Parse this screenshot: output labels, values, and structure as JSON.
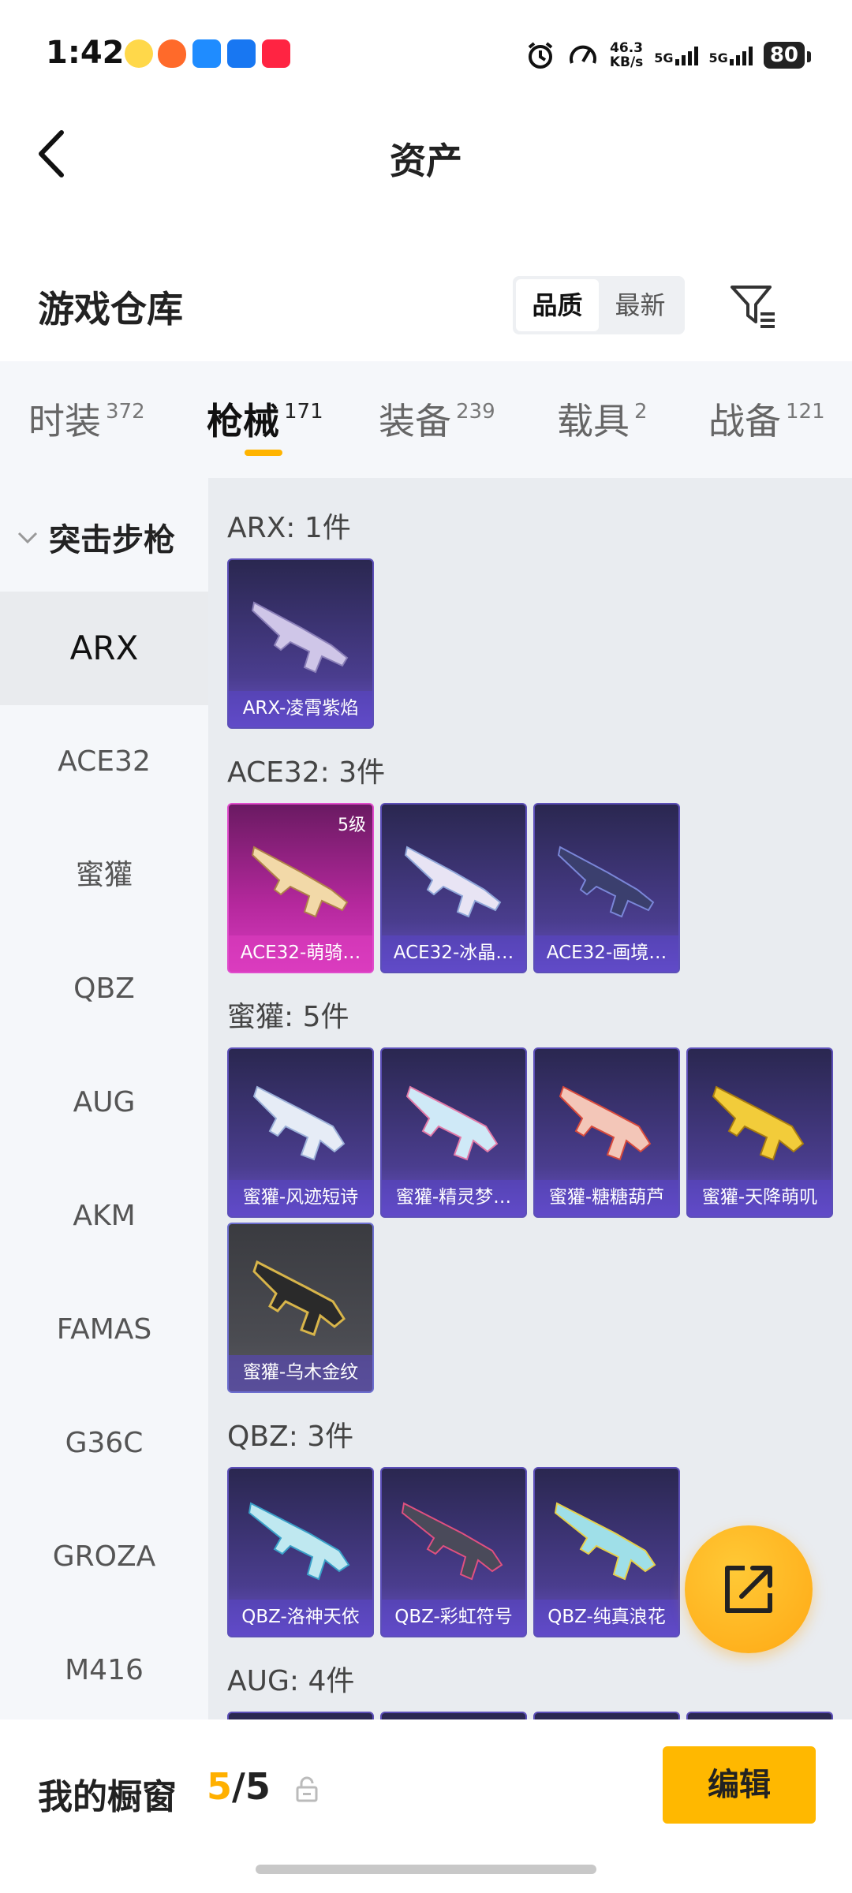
{
  "status_bar": {
    "time": "1:42",
    "speed_value": "46.3",
    "speed_unit": "KB/s",
    "net1": "5G",
    "net2": "5G",
    "battery": "80",
    "notification_icons": [
      "bunny-app-icon",
      "pumpkin-app-icon",
      "blue-app-icon",
      "blue-arrow-app-icon",
      "redbook-app-icon"
    ],
    "system_icons": [
      "alarm-icon",
      "speedometer-icon"
    ]
  },
  "header": {
    "title": "资产"
  },
  "warehouse": {
    "title": "游戏仓库",
    "sort_options": [
      "品质",
      "最新"
    ],
    "sort_selected": "品质"
  },
  "tabs": [
    {
      "label": "时装",
      "count": "372"
    },
    {
      "label": "枪械",
      "count": "171"
    },
    {
      "label": "装备",
      "count": "239"
    },
    {
      "label": "载具",
      "count": "2"
    },
    {
      "label": "战备",
      "count": "121"
    }
  ],
  "active_tab": "枪械",
  "sidebar": {
    "category": "突击步枪",
    "items": [
      "ARX",
      "ACE32",
      "蜜獾",
      "QBZ",
      "AUG",
      "AKM",
      "FAMAS",
      "G36C",
      "GROZA",
      "M416"
    ],
    "selected": "ARX"
  },
  "groups": [
    {
      "title": "ARX: 1件",
      "items": [
        {
          "name": "ARX-凌霄紫焰"
        }
      ]
    },
    {
      "title": "ACE32: 3件",
      "items": [
        {
          "name": "ACE32-萌骑…",
          "level": "5级"
        },
        {
          "name": "ACE32-冰晶…"
        },
        {
          "name": "ACE32-画境…"
        }
      ]
    },
    {
      "title": "蜜獾: 5件",
      "items": [
        {
          "name": "蜜獾-风迹短诗"
        },
        {
          "name": "蜜獾-精灵梦…"
        },
        {
          "name": "蜜獾-糖糖葫芦"
        },
        {
          "name": "蜜獾-天降萌叽"
        },
        {
          "name": "蜜獾-乌木金纹"
        }
      ]
    },
    {
      "title": "QBZ: 3件",
      "items": [
        {
          "name": "QBZ-洛神天依"
        },
        {
          "name": "QBZ-彩虹符号"
        },
        {
          "name": "QBZ-纯真浪花"
        }
      ]
    },
    {
      "title": "AUG: 4件",
      "items": []
    }
  ],
  "showcase": {
    "label": "我的橱窗",
    "current": "5",
    "separator": "/",
    "total": "5"
  },
  "edit_button": "编辑",
  "colors": {
    "accent": "#ffb800",
    "card_purple": "#4a3d8e",
    "card_pink": "#d83cc0",
    "card_gray": "#4b4c52"
  }
}
